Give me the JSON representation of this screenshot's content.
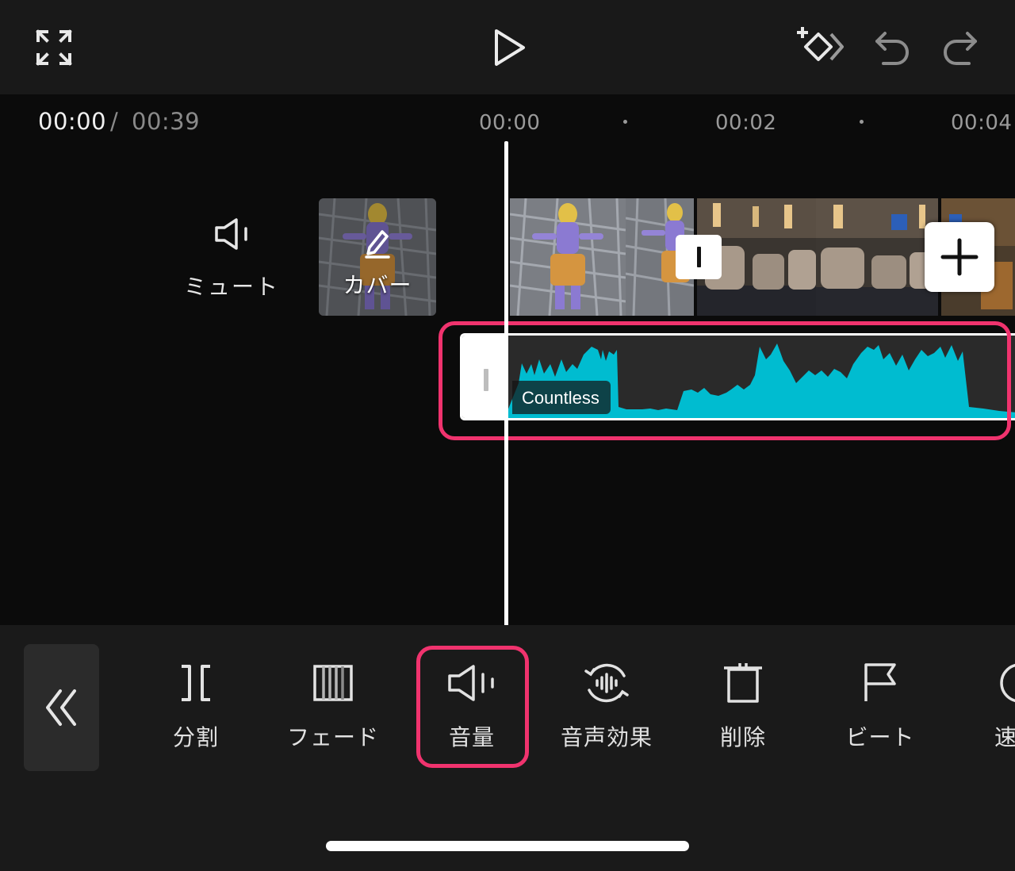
{
  "header": {
    "fullscreen_icon": "expand-icon",
    "play_icon": "play-icon",
    "keyframe_icon": "add-keyframe-icon",
    "undo_icon": "undo-icon",
    "redo_icon": "redo-icon"
  },
  "time": {
    "current": "00:00",
    "separator": "/",
    "total": "00:39"
  },
  "ruler": {
    "labels": [
      "00:00",
      "00:02",
      "00:04"
    ]
  },
  "tracks": {
    "mute_label": "ミュート",
    "cover_label": "カバー",
    "audio_name": "Countless"
  },
  "toolbar": {
    "back_icon": "double-chevron-left-icon",
    "items": [
      {
        "label": "分割",
        "icon": "split-icon"
      },
      {
        "label": "フェード",
        "icon": "fade-icon"
      },
      {
        "label": "音量",
        "icon": "volume-icon"
      },
      {
        "label": "音声効果",
        "icon": "voice-effect-icon"
      },
      {
        "label": "削除",
        "icon": "delete-icon"
      },
      {
        "label": "ビート",
        "icon": "beat-flag-icon"
      },
      {
        "label": "速",
        "icon": "speed-icon"
      }
    ]
  },
  "colors": {
    "accent_highlight": "#f0336e",
    "waveform": "#00bcd0",
    "background": "#0b0b0b",
    "toolbar_bg": "#1a1a1a"
  }
}
